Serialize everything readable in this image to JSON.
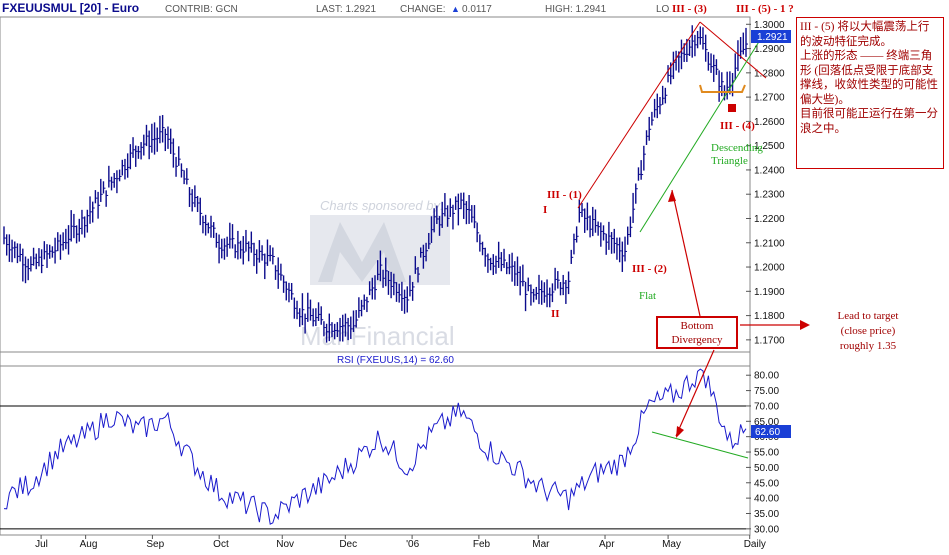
{
  "header": {
    "symbol": "FXEUUSMUL [20] - Euro",
    "contrib": "CONTRIB: GCN",
    "last": "LAST: 1.2921",
    "change_label": "CHANGE:",
    "change_arrow": "▲",
    "change_value": "0.0117",
    "high": "HIGH: 1.2941",
    "low_partial": "LO"
  },
  "watermark": {
    "sponsor": "Charts sponsored by:",
    "brand": "ManFinancial"
  },
  "rsi_title": "RSI (FXEUUS,14) = 62.60",
  "colors": {
    "price": "#0b0b8c",
    "rsi": "#1a1acc",
    "annotation_red": "#cc0000",
    "annotation_green": "#22aa22",
    "last_box": "#1a3fd6",
    "orange": "#e08a1e"
  },
  "annotations": {
    "waves": [
      {
        "text": "I",
        "color": "#cc0000"
      },
      {
        "text": "II",
        "color": "#cc0000"
      },
      {
        "text": "III - (1)",
        "color": "#cc0000"
      },
      {
        "text": "III - (2)",
        "color": "#cc0000"
      },
      {
        "text": "III - (3)",
        "color": "#cc0000"
      },
      {
        "text": "III - (4)",
        "color": "#cc0000"
      },
      {
        "text": "III - (5) - 1 ?",
        "color": "#cc0000"
      },
      {
        "text": "Flat",
        "color": "#22aa22"
      },
      {
        "text": "Descending",
        "color": "#22aa22"
      },
      {
        "text": "Triangle",
        "color": "#22aa22"
      }
    ],
    "note": "III - (5) 将以大幅震荡上行的波动特征完成。\n上涨的形态 —— 终端三角形 (回落低点受限于底部支撑线，收敛性类型的可能性偏大些)。\n目前很可能正运行在第一分浪之中。",
    "divergence": "Bottom\nDivergency",
    "target": "Lead to target\n(close price)\nroughly 1.35"
  },
  "chart_data": [
    {
      "type": "line",
      "title": "FXEUUSMUL [20] - Euro",
      "xlabel": "",
      "ylabel": "",
      "x_ticks": [
        "Jul",
        "Aug",
        "Sep",
        "Oct",
        "Nov",
        "Dec",
        "'06",
        "Feb",
        "Mar",
        "Apr",
        "May",
        "Daily"
      ],
      "y_ticks": [
        1.17,
        1.18,
        1.19,
        1.2,
        1.21,
        1.22,
        1.23,
        1.24,
        1.25,
        1.26,
        1.27,
        1.28,
        1.29,
        1.3
      ],
      "y_tick_labels": [
        "1.1700",
        "1.1800",
        "1.1900",
        "1.2000",
        "1.2100",
        "1.2200",
        "1.2300",
        "1.2400",
        "1.2500",
        "1.2600",
        "1.2700",
        "1.2800",
        "1.2900",
        "1.3000"
      ],
      "ylim": [
        1.165,
        1.303
      ],
      "last_label": "1.2921",
      "x": [
        0,
        10,
        20,
        30,
        40,
        50,
        60,
        70,
        80,
        90,
        100,
        110,
        120,
        130,
        140,
        150,
        160,
        170,
        180,
        190,
        200,
        210,
        220,
        230,
        240,
        250
      ],
      "series": [
        {
          "values": [
            1.212,
            1.2,
            1.208,
            1.22,
            1.235,
            1.25,
            1.255,
            1.228,
            1.21,
            1.208,
            1.202,
            1.182,
            1.176,
            1.176,
            1.198,
            1.188,
            1.218,
            1.226,
            1.204,
            1.198,
            1.19,
            1.195,
            1.216,
            1.207,
            1.258,
            1.284
          ]
        }
      ],
      "key_points": [
        {
          "label": "I",
          "x": 173,
          "value": 1.222
        },
        {
          "label": "II",
          "x": 197,
          "value": 1.186
        },
        {
          "label": "III - (1)",
          "x": 214,
          "value": 1.222
        },
        {
          "label": "III - (2)",
          "x": 231,
          "value": 1.207
        },
        {
          "label": "III - (3)",
          "x": 258,
          "value": 1.296
        },
        {
          "label": "III - (4)",
          "x": 268,
          "value": 1.272
        },
        {
          "label": "last",
          "x": 276,
          "value": 1.2921
        }
      ]
    },
    {
      "type": "line",
      "title": "RSI (FXEUUS,14) = 62.60",
      "xlabel": "",
      "ylabel": "",
      "y_ticks": [
        30,
        35,
        40,
        45,
        50,
        55,
        60,
        65,
        70,
        75,
        80
      ],
      "y_tick_labels": [
        "30.00",
        "35.00",
        "40.00",
        "45.00",
        "50.00",
        "55.00",
        "60.00",
        "65.00",
        "70.00",
        "75.00",
        "80.00"
      ],
      "ylim": [
        28,
        83
      ],
      "reference_lines": [
        70,
        30
      ],
      "last_label": "62.60",
      "x": [
        0,
        10,
        20,
        30,
        40,
        50,
        60,
        70,
        80,
        90,
        100,
        110,
        120,
        130,
        140,
        150,
        160,
        170,
        180,
        190,
        200,
        210,
        220,
        230,
        240,
        250,
        260,
        270,
        276
      ],
      "series": [
        {
          "values": [
            40,
            45,
            55,
            60,
            67,
            62,
            66,
            52,
            42,
            38,
            34,
            40,
            45,
            52,
            60,
            50,
            62,
            68,
            56,
            50,
            43,
            40,
            48,
            52,
            70,
            74,
            82,
            58,
            62.6
          ]
        }
      ]
    }
  ]
}
